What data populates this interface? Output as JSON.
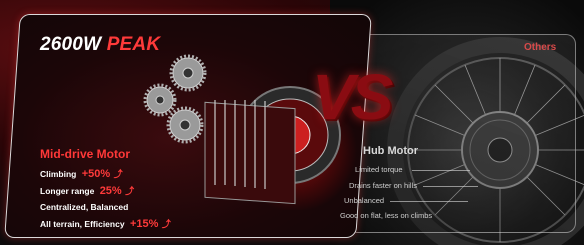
{
  "headline": {
    "wattage": "2600W",
    "peak": "PEAK"
  },
  "mid_drive": {
    "title": "Mid-drive Motor",
    "features": [
      {
        "label": "Climbing",
        "value": "+50%"
      },
      {
        "label": "Longer range",
        "value": "25%"
      },
      {
        "label": "Centralized, Balanced",
        "value": ""
      },
      {
        "label": "All terrain, Efficiency",
        "value": "+15%"
      }
    ]
  },
  "versus": "VS",
  "others": {
    "label": "Others",
    "title": "Hub Motor",
    "items": [
      "Limited torque",
      "Drains faster on hills",
      "Unbalanced",
      "Good on flat, less on climbs"
    ]
  },
  "colors": {
    "accent": "#ff3a3a",
    "background": "#0c0b0c",
    "vs": "#8a0c12"
  },
  "icons": [
    "gear-icon",
    "up-arrow-icon"
  ]
}
